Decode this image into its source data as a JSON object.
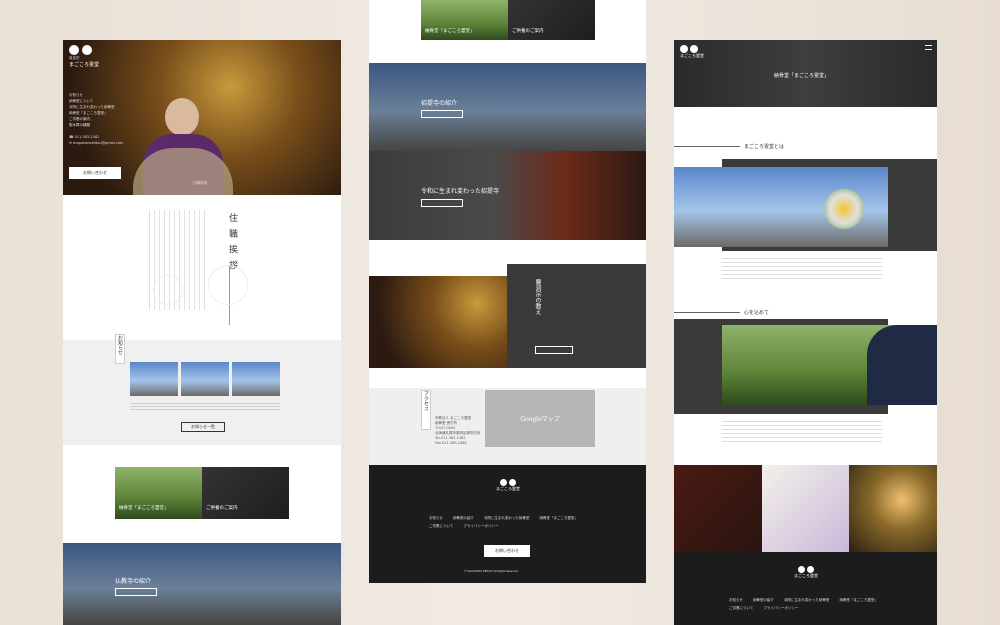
{
  "brand": {
    "small": "真言宗",
    "name": "まごころ霊堂",
    "sub": "MAGOKORO"
  },
  "left": {
    "nav": [
      "お知らせ",
      "納骨堂について",
      "寺院に生まれ変わった納骨堂",
      "納骨堂「まごころ霊堂」",
      "ご供養の案内",
      "樹木葬の種類"
    ],
    "tel": "011-383-2482",
    "email": "magokororeidou@gmail.com",
    "contact_btn": "お問い合わせ",
    "caption": "住職挨拶",
    "greeting_heading": "住 職 挨 拶",
    "news_label": "お知らせ",
    "more_btn": "お知らせ一覧",
    "banner1": "納骨堂「まごころ霊堂」",
    "banner2": "ご供養のご案内",
    "temple_label": "仏教寺の紹介"
  },
  "mid": {
    "banner1": "納骨堂「まごころ霊堂」",
    "banner2": "ご供養のご案内",
    "temple_intro": "招提寺の紹介",
    "reborn": "令和に生まれ変わった招提寺",
    "teaching": "曹洞宗の教え",
    "access": "アクセス",
    "map": "Googleマップ",
    "address_lines": [
      "宗教法人 まごころ霊堂",
      "納骨堂 受付所",
      "〒047-0000",
      "北海道札幌市厚別区厚別中央",
      "Tel.011-383-2482",
      "Fax.011-383-2482"
    ],
    "footer_links": [
      "お知らせ",
      "納骨堂の紹介",
      "寺院に生まれ変わった納骨堂",
      "納骨堂「まごころ霊堂」",
      "ご供養について",
      "プライバシーポリシー"
    ],
    "footer_btn": "お問い合わせ",
    "copyright": "© MAGOKORO REIDOU All Rights Reserved."
  },
  "right": {
    "hero_title": "納骨堂「まごころ霊堂」",
    "about_label": "まごころ霊堂とは",
    "kokoro_label": "心を込めて",
    "footer_links": [
      "お知らせ",
      "納骨堂の紹介",
      "寺院に生まれ変わった納骨堂",
      "納骨堂「まごころ霊堂」",
      "ご供養について",
      "プライバシーポリシー"
    ]
  }
}
